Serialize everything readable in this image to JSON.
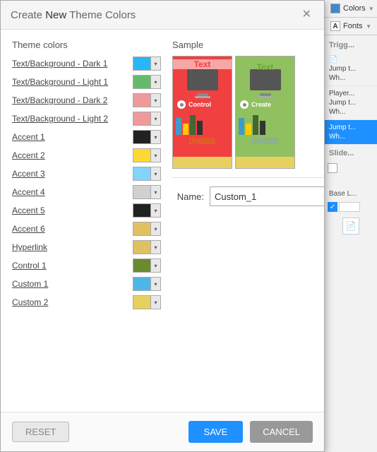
{
  "dialog": {
    "title_create": "Create ",
    "title_new": "New",
    "title_theme_colors": " Theme Colors",
    "section_theme": "Theme colors",
    "section_sample": "Sample",
    "name_label": "Name:",
    "name_value": "Custom_1",
    "name_placeholder": "Custom_1"
  },
  "colors": [
    {
      "id": "txt-bg-dark1",
      "label": "Text/Background - Dark 1",
      "color": "#29b6f6"
    },
    {
      "id": "txt-bg-light1",
      "label": "Text/Background - Light 1",
      "color": "#66bb6a"
    },
    {
      "id": "txt-bg-dark2",
      "label": "Text/Background - Dark 2",
      "color": "#ef9a9a"
    },
    {
      "id": "txt-bg-light2",
      "label": "Text/Background - Light 2",
      "color": "#ef9a9a"
    },
    {
      "id": "accent1",
      "label": "Accent 1",
      "color": "#212121"
    },
    {
      "id": "accent2",
      "label": "Accent 2",
      "color": "#fdd835"
    },
    {
      "id": "accent3",
      "label": "Accent 3",
      "color": "#81d4fa"
    },
    {
      "id": "accent4",
      "label": "Accent 4",
      "color": "#d0d0d0"
    },
    {
      "id": "accent5",
      "label": "Accent 5",
      "color": "#212121"
    },
    {
      "id": "accent6",
      "label": "Accent 6",
      "color": "#e0c060"
    },
    {
      "id": "hyperlink",
      "label": "Hyperlink",
      "color": "#e0c060"
    },
    {
      "id": "control1",
      "label": "Control 1",
      "color": "#6a8a30"
    },
    {
      "id": "custom1",
      "label": "Custom 1",
      "color": "#4db6e8"
    },
    {
      "id": "custom2",
      "label": "Custom 2",
      "color": "#e8d060"
    }
  ],
  "sample": {
    "text_label": "Text",
    "hyperlink_label": "Hyperlink",
    "create_label": "Create",
    "hyperlink2_label": "Hyperlink"
  },
  "buttons": {
    "reset": "RESET",
    "save": "SAVE",
    "cancel": "CANCEL"
  },
  "right_panel": {
    "colors_label": "Colors",
    "fonts_label": "Fonts",
    "trigger_label": "Trigg...",
    "jump1": "Jump t... Wh...",
    "player_label": "Player...",
    "jump2": "Jump t... Wh...",
    "jump3": "Jump t... Wh...",
    "slide_label": "Slide...",
    "base_label": "Base L..."
  }
}
